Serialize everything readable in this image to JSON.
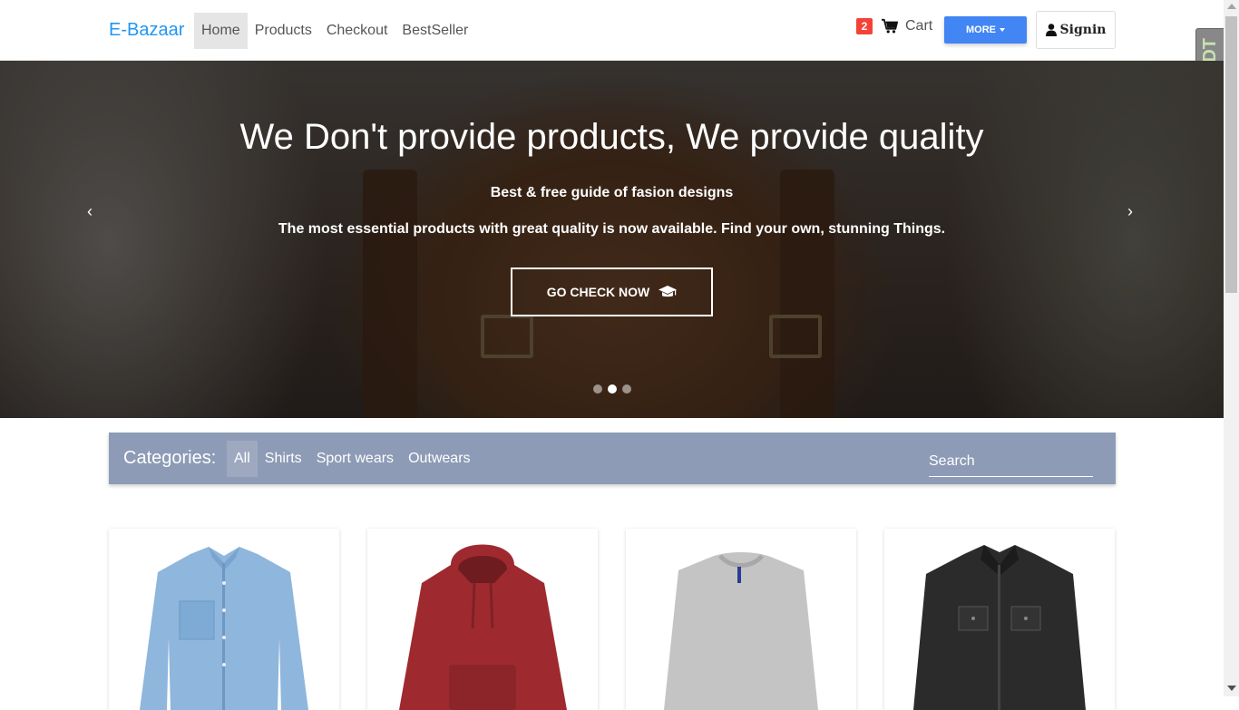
{
  "nav": {
    "brand": "E-Bazaar",
    "links": [
      "Home",
      "Products",
      "Checkout",
      "BestSeller"
    ],
    "cart_count": "2",
    "cart_label": "Cart",
    "more_label": "MORE",
    "signin_label": "Signin"
  },
  "side_tab": "DJDT",
  "hero": {
    "title": "We Don't provide products, We provide quality",
    "subtitle": "Best & free guide of fasion designs",
    "description": "The most essential products with great quality is now available. Find your own, stunning Things.",
    "cta_label": "GO CHECK NOW",
    "active_slide": 2,
    "slide_count": 3
  },
  "categories": {
    "title": "Categories:",
    "links": [
      "All",
      "Shirts",
      "Sport wears",
      "Outwears"
    ],
    "search_placeholder": "Search"
  },
  "products": [
    {
      "item": "denim-shirt",
      "color": "#8fb6dc"
    },
    {
      "item": "red-hoodie",
      "color": "#9e2a2f"
    },
    {
      "item": "grey-sweater",
      "color": "#c4c4c4"
    },
    {
      "item": "black-denim-jacket",
      "color": "#2b2b2b"
    }
  ],
  "colors": {
    "brand": "#2196f3",
    "badge": "#f44336",
    "more_button": "#4285f4",
    "category_bar": "#8d9bb6"
  }
}
